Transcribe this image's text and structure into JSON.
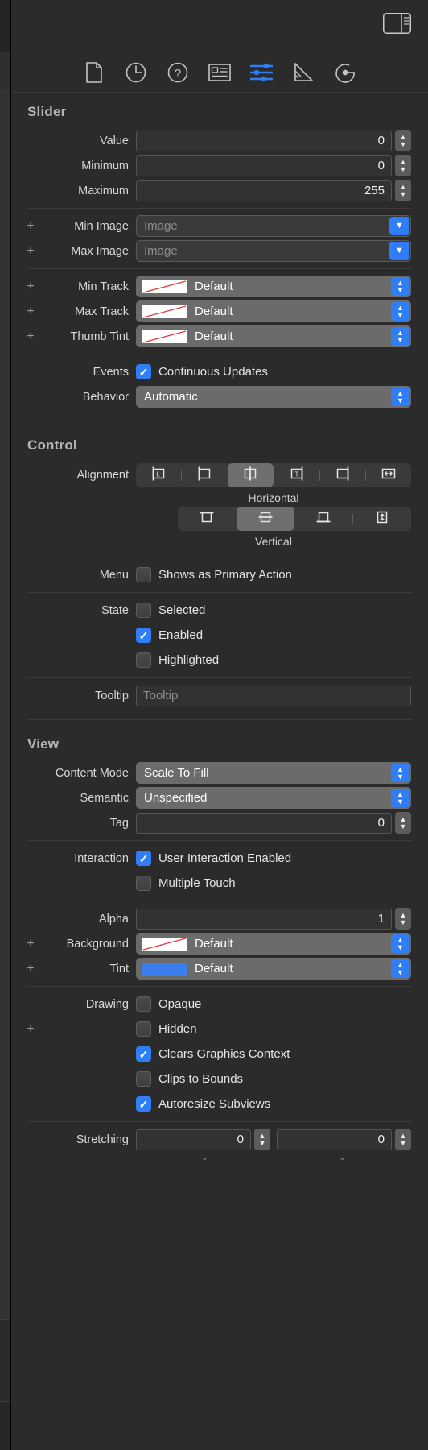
{
  "titlebar": {
    "panel_toggle_icon": "inspector-panel-toggle-icon"
  },
  "tabbar": {
    "tabs": [
      {
        "name": "file-inspector-tab",
        "icon": "document-icon",
        "selected": false
      },
      {
        "name": "history-inspector-tab",
        "icon": "clock-icon",
        "selected": false
      },
      {
        "name": "quick-help-inspector-tab",
        "icon": "question-mark-circle-icon",
        "selected": false
      },
      {
        "name": "identity-inspector-tab",
        "icon": "id-card-icon",
        "selected": false
      },
      {
        "name": "attributes-inspector-tab",
        "icon": "sliders-icon",
        "selected": true
      },
      {
        "name": "size-inspector-tab",
        "icon": "ruler-triangle-icon",
        "selected": false
      },
      {
        "name": "connections-inspector-tab",
        "icon": "connections-arrow-icon",
        "selected": false
      }
    ]
  },
  "colors": {
    "accent_blue": "#2f7ef7",
    "tint_swatch_blue": "#3a7ef0",
    "default_swatch_slash": "#e03b2f",
    "panel_bg": "#2b2b2b",
    "field_bg": "#323232",
    "popup_bg": "#6b6b6b"
  },
  "slider_section": {
    "title": "Slider",
    "value": {
      "label": "Value",
      "value": "0"
    },
    "minimum": {
      "label": "Minimum",
      "value": "0"
    },
    "maximum": {
      "label": "Maximum",
      "value": "255"
    },
    "min_image": {
      "label": "Min Image",
      "placeholder": "Image",
      "value": ""
    },
    "max_image": {
      "label": "Max Image",
      "placeholder": "Image",
      "value": ""
    },
    "min_track": {
      "label": "Min Track",
      "value": "Default",
      "swatch": "default-diagonal"
    },
    "max_track": {
      "label": "Max Track",
      "value": "Default",
      "swatch": "default-diagonal"
    },
    "thumb_tint": {
      "label": "Thumb Tint",
      "value": "Default",
      "swatch": "default-diagonal"
    },
    "events": {
      "label": "Events",
      "checkbox_label": "Continuous Updates",
      "checked": true
    },
    "behavior": {
      "label": "Behavior",
      "value": "Automatic"
    }
  },
  "control_section": {
    "title": "Control",
    "alignment": {
      "label": "Alignment",
      "horizontal_caption": "Horizontal",
      "vertical_caption": "Vertical",
      "horizontal_options": [
        {
          "name": "align-left",
          "icon": "align-left-icon",
          "selected": false
        },
        {
          "name": "align-leading",
          "icon": "align-leading-icon",
          "selected": false
        },
        {
          "name": "align-center-horizontal",
          "icon": "align-center-horizontal-icon",
          "selected": true
        },
        {
          "name": "align-trailing",
          "icon": "align-trailing-icon",
          "selected": false
        },
        {
          "name": "align-right",
          "icon": "align-right-icon",
          "selected": false
        },
        {
          "name": "align-fill-horizontal",
          "icon": "align-fill-horizontal-icon",
          "selected": false
        }
      ],
      "vertical_options": [
        {
          "name": "align-top",
          "icon": "align-top-icon",
          "selected": false
        },
        {
          "name": "align-center-vertical",
          "icon": "align-center-vertical-icon",
          "selected": true
        },
        {
          "name": "align-bottom",
          "icon": "align-bottom-icon",
          "selected": false
        },
        {
          "name": "align-fill-vertical",
          "icon": "align-fill-vertical-icon",
          "selected": false
        }
      ]
    },
    "menu": {
      "label": "Menu",
      "checkbox_label": "Shows as Primary Action",
      "checked": false
    },
    "state": {
      "label": "State",
      "items": [
        {
          "label": "Selected",
          "checked": false
        },
        {
          "label": "Enabled",
          "checked": true
        },
        {
          "label": "Highlighted",
          "checked": false
        }
      ]
    },
    "tooltip": {
      "label": "Tooltip",
      "placeholder": "Tooltip",
      "value": ""
    }
  },
  "view_section": {
    "title": "View",
    "content_mode": {
      "label": "Content Mode",
      "value": "Scale To Fill"
    },
    "semantic": {
      "label": "Semantic",
      "value": "Unspecified"
    },
    "tag": {
      "label": "Tag",
      "value": "0"
    },
    "interaction": {
      "label": "Interaction",
      "items": [
        {
          "label": "User Interaction Enabled",
          "checked": true
        },
        {
          "label": "Multiple Touch",
          "checked": false
        }
      ]
    },
    "alpha": {
      "label": "Alpha",
      "value": "1"
    },
    "background": {
      "label": "Background",
      "value": "Default",
      "swatch": "default-diagonal"
    },
    "tint": {
      "label": "Tint",
      "value": "Default",
      "swatch": "blue"
    },
    "drawing": {
      "label": "Drawing",
      "items": [
        {
          "label": "Opaque",
          "checked": false,
          "has_plus": false
        },
        {
          "label": "Hidden",
          "checked": false,
          "has_plus": true
        },
        {
          "label": "Clears Graphics Context",
          "checked": true,
          "has_plus": false
        },
        {
          "label": "Clips to Bounds",
          "checked": false,
          "has_plus": false
        },
        {
          "label": "Autoresize Subviews",
          "checked": true,
          "has_plus": false
        }
      ]
    },
    "stretching": {
      "label": "Stretching",
      "x": "0",
      "y": "0"
    }
  }
}
